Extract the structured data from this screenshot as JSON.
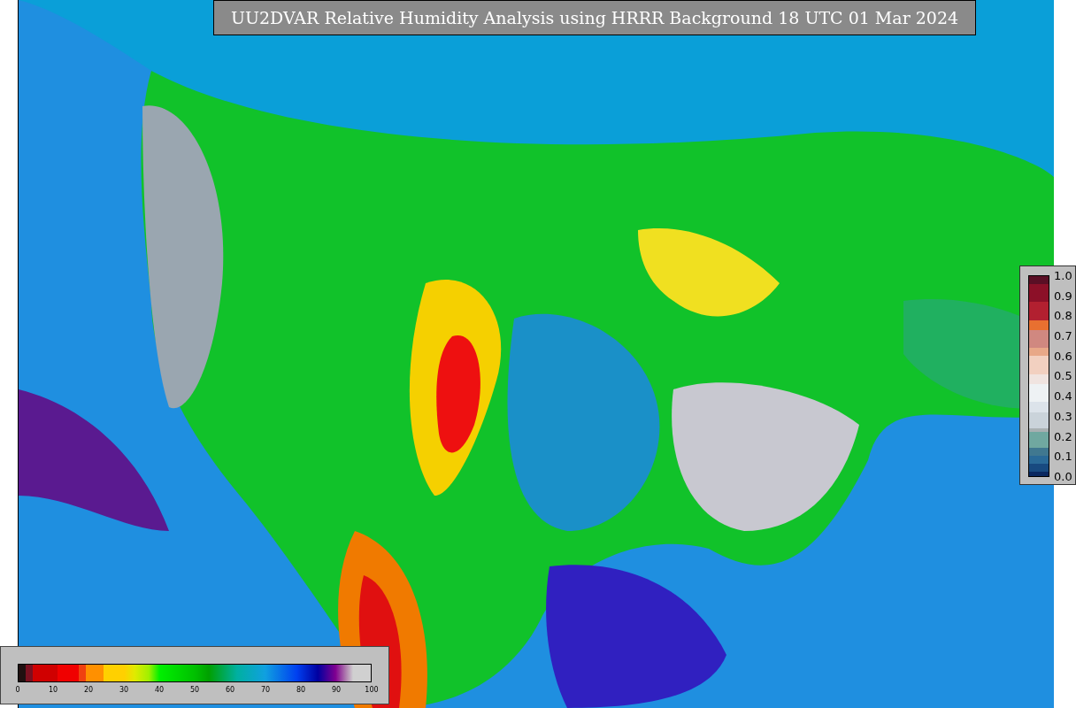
{
  "title": "UU2DVAR Relative Humidity Analysis using HRRR Background 18 UTC 01 Mar 2024",
  "observation_colorbar": {
    "ticks": [
      "1.0",
      "0.9",
      "0.8",
      "0.7",
      "0.6",
      "0.5",
      "0.4",
      "0.3",
      "0.2",
      "0.1",
      "0.0"
    ]
  },
  "humidity_colorbar": {
    "ticks": [
      "0",
      "10",
      "20",
      "30",
      "40",
      "50",
      "60",
      "70",
      "80",
      "90",
      "100"
    ]
  }
}
